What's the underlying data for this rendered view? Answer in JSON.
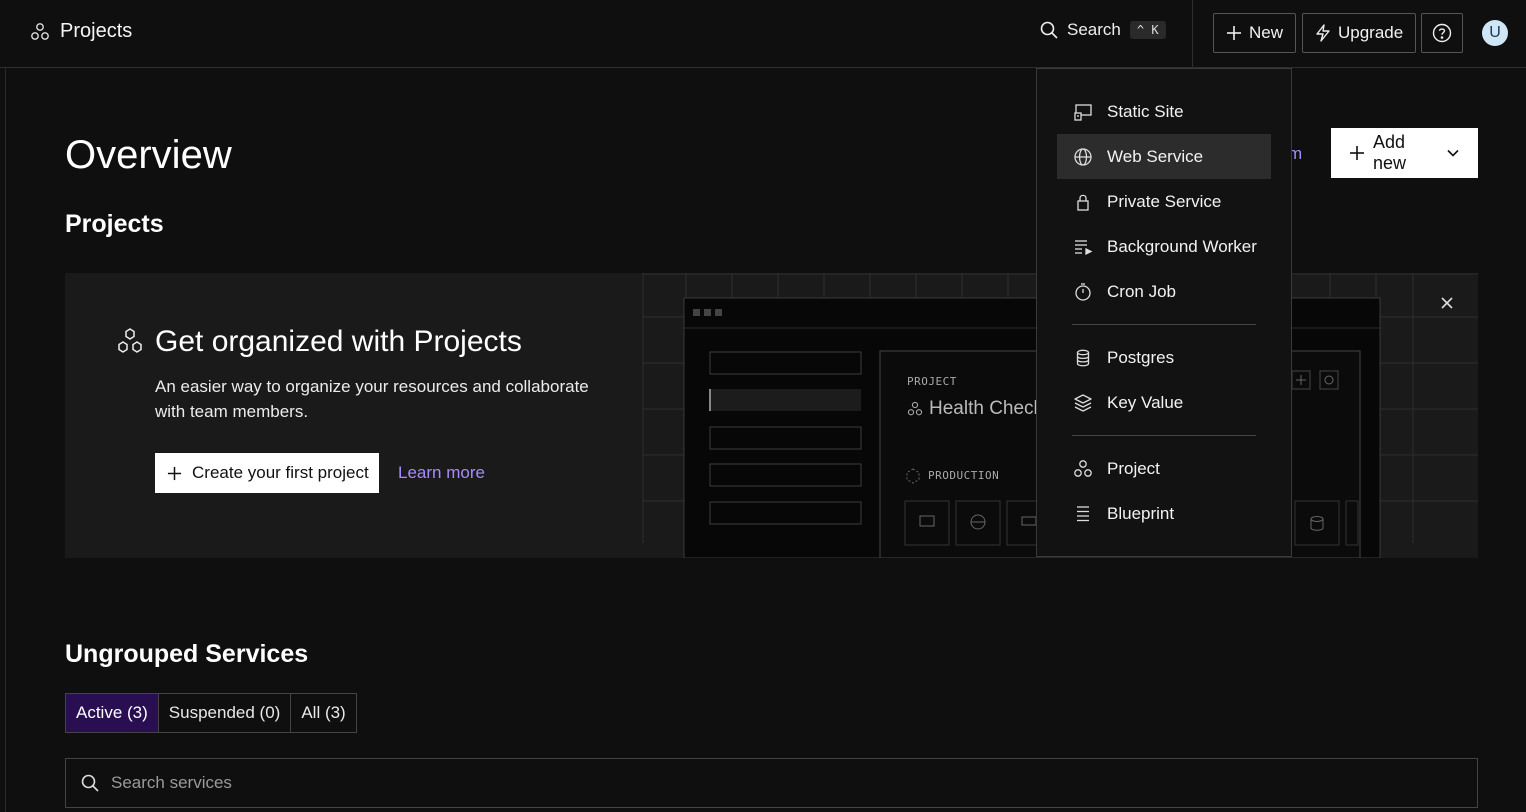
{
  "topbar": {
    "brand": "Projects",
    "search_label": "Search",
    "search_shortcut": "^ K",
    "new_label": "New",
    "upgrade_label": "Upgrade",
    "avatar_initial": "U"
  },
  "main": {
    "overview_title": "Overview",
    "projects_heading": "Projects",
    "partial_link": "m",
    "add_new_label": "Add new"
  },
  "banner": {
    "title": "Get organized with Projects",
    "description": "An easier way to organize your resources and collaborate with team members.",
    "create_label": "Create your first project",
    "learn_more_label": "Learn more",
    "art_project_label": "PROJECT",
    "art_project_name": "Health Check",
    "art_environment_label": "PRODUCTION"
  },
  "ungrouped": {
    "heading": "Ungrouped Services",
    "tabs": [
      {
        "label": "Active (3)",
        "active": true
      },
      {
        "label": "Suspended (0)",
        "active": false
      },
      {
        "label": "All (3)",
        "active": false
      }
    ],
    "search_placeholder": "Search services"
  },
  "dropdown": {
    "group1": [
      {
        "label": "Static Site",
        "icon": "static-site-icon"
      },
      {
        "label": "Web Service",
        "icon": "globe-icon",
        "highlighted": true
      },
      {
        "label": "Private Service",
        "icon": "lock-icon"
      },
      {
        "label": "Background Worker",
        "icon": "worker-icon"
      },
      {
        "label": "Cron Job",
        "icon": "timer-icon"
      }
    ],
    "group2": [
      {
        "label": "Postgres",
        "icon": "database-icon"
      },
      {
        "label": "Key Value",
        "icon": "layers-icon"
      }
    ],
    "group3": [
      {
        "label": "Project",
        "icon": "project-icon"
      },
      {
        "label": "Blueprint",
        "icon": "blueprint-icon"
      }
    ]
  },
  "colors": {
    "background": "#0f0f0f",
    "banner": "#1a1a1a",
    "accent_link": "#a78bfa",
    "active_tab": "#2a0e52",
    "avatar": "#cfe6f7"
  }
}
